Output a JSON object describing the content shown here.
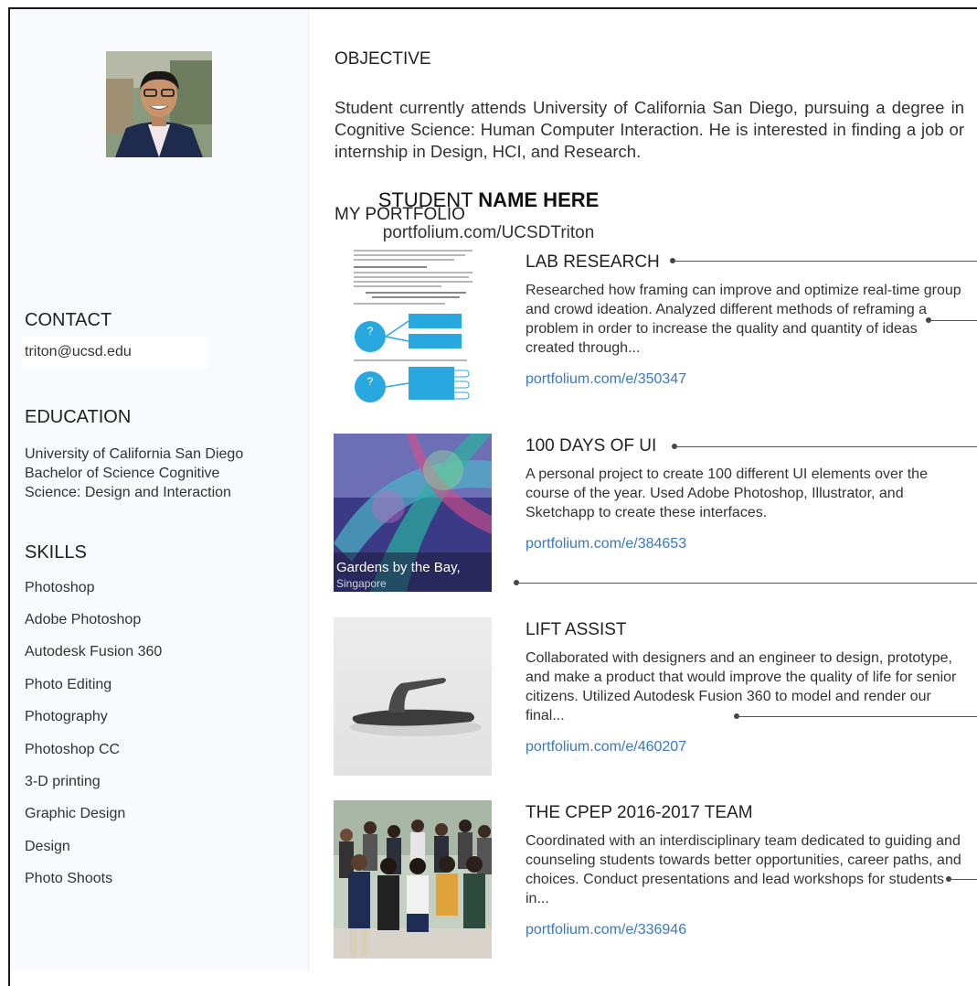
{
  "profile": {
    "name_regular": "STUDENT ",
    "name_bold": "NAME HERE",
    "url": "portfolium.com/UCSDTriton"
  },
  "contact": {
    "title": "CONTACT",
    "email": "triton@ucsd.edu"
  },
  "education": {
    "title": "EDUCATION",
    "line1": "University of California San Diego",
    "line2": "Bachelor of Science Cognitive",
    "line3": "Science: Design and Interaction"
  },
  "skills": {
    "title": "SKILLS",
    "items": [
      "Photoshop",
      "Adobe Photoshop",
      "Autodesk Fusion 360",
      "Photo Editing",
      "Photography",
      "Photoshop CC",
      "3-D printing",
      "Graphic Design",
      "Design",
      "Photo Shoots"
    ]
  },
  "objective": {
    "title": "OBJECTIVE",
    "text": "Student currently attends University of California San Diego, pursuing a degree in Cognitive Science: Human Computer Interaction. He is interested in finding a job or internship in Design, HCI, and Research."
  },
  "portfolio": {
    "title": "MY PORTFOLIO",
    "items": [
      {
        "title": "LAB RESEARCH",
        "description": "Researched how framing can improve and optimize real-time group and crowd ideation. Analyzed different methods of reframing a problem in order to increase the quality and quantity of ideas created through...",
        "link": "portfolium.com/e/350347"
      },
      {
        "title": "100 DAYS OF UI",
        "description": "A personal project to create 100 different UI elements over the course of the year. Used Adobe Photoshop, Illustrator, and Sketchapp to create these interfaces.",
        "link": "portfolium.com/e/384653",
        "image_caption": "Gardens by the Bay,",
        "image_subcaption": "Singapore"
      },
      {
        "title": "LIFT ASSIST",
        "description": "Collaborated with designers and an engineer to design, prototype, and make a product that would improve the quality of life for senior citizens. Utilized Autodesk Fusion 360 to model and render our final...",
        "link": "portfolium.com/e/460207"
      },
      {
        "title": "THE CPEP 2016-2017 TEAM",
        "description": "Coordinated with an interdisciplinary team dedicated to guiding and counseling students towards better opportunities, career paths, and choices. Conduct presentations and lead workshops for students in...",
        "link": "portfolium.com/e/336946"
      }
    ]
  },
  "colors": {
    "link": "#3a78c0",
    "sidebar_bg": "#f8fafd",
    "text": "#333333"
  }
}
